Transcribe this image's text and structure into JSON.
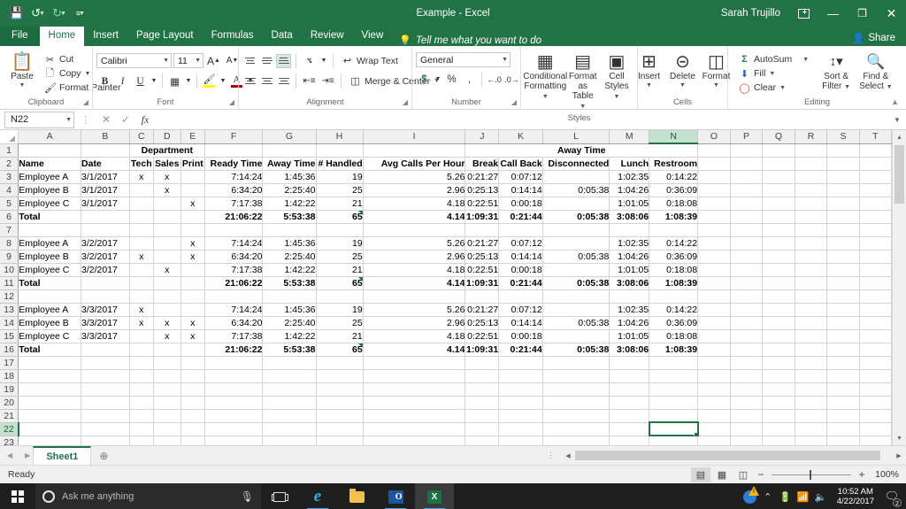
{
  "window": {
    "title": "Example  -  Excel",
    "user": "Sarah Trujillo",
    "qat": {
      "save": "save-icon",
      "undo": "undo-icon",
      "redo": "redo-icon",
      "customize": "customize-icon"
    },
    "buttons": {
      "account": "account-icon",
      "minimize": "—",
      "restore": "❐",
      "close": "✕"
    }
  },
  "tabs": {
    "items": [
      "File",
      "Home",
      "Insert",
      "Page Layout",
      "Formulas",
      "Data",
      "Review",
      "View"
    ],
    "active": "Home",
    "tellme": "Tell me what you want to do",
    "share": "Share"
  },
  "ribbon": {
    "clipboard": {
      "label": "Clipboard",
      "paste": "Paste",
      "cut": "Cut",
      "copy": "Copy",
      "format_painter": "Format Painter"
    },
    "font": {
      "label": "Font",
      "name": "Calibri",
      "size": "11",
      "bold": "B",
      "italic": "I",
      "underline": "U",
      "grow": "A",
      "shrink": "A",
      "borders": "borders-icon",
      "fill": "fill-color-icon",
      "fontcolor": "font-color-icon"
    },
    "alignment": {
      "label": "Alignment",
      "wrap_text": "Wrap Text",
      "merge_center": "Merge & Center",
      "orientation": "orientation-icon",
      "indent_dec": "decrease-indent-icon",
      "indent_inc": "increase-indent-icon"
    },
    "number": {
      "label": "Number",
      "format": "General",
      "currency": "$",
      "percent": "%",
      "comma": ",",
      "inc_decimal": "increase-decimal-icon",
      "dec_decimal": "decrease-decimal-icon"
    },
    "styles": {
      "label": "Styles",
      "conditional_formatting": [
        "Conditional",
        "Formatting"
      ],
      "format_as_table": [
        "Format as",
        "Table"
      ],
      "cell_styles": [
        "Cell",
        "Styles"
      ]
    },
    "cells": {
      "label": "Cells",
      "insert": "Insert",
      "delete": "Delete",
      "format": "Format"
    },
    "editing": {
      "label": "Editing",
      "autosum": "AutoSum",
      "fill": "Fill",
      "clear": "Clear",
      "sort_filter": [
        "Sort &",
        "Filter"
      ],
      "find_select": [
        "Find &",
        "Select"
      ],
      "collapse": "collapse-ribbon-icon"
    }
  },
  "formula_bar": {
    "name_box": "N22",
    "formula": "",
    "cancel": "✕",
    "enter": "✓",
    "fx": "fx"
  },
  "grid": {
    "columns": [
      "A",
      "B",
      "C",
      "D",
      "E",
      "F",
      "G",
      "H",
      "I",
      "J",
      "K",
      "L",
      "M",
      "N",
      "O",
      "P",
      "Q",
      "R",
      "S",
      "T"
    ],
    "selected_column": "N",
    "selected_row": 22,
    "selected_cell": "N22",
    "rows": [
      {
        "n": 1,
        "type": "group-header",
        "cells": {
          "D": "Department",
          "L": "Away Time"
        }
      },
      {
        "n": 2,
        "type": "header",
        "cells": {
          "A": "Name",
          "B": "Date",
          "C": "Tech",
          "D": "Sales",
          "E": "Print",
          "F": "Ready Time",
          "G": "Away Time",
          "H": "# Handled",
          "I": "Avg Calls Per Hour",
          "J": "Break",
          "K": "Call Back",
          "L": "Disconnected",
          "M": "Lunch",
          "N": "Restroom"
        }
      },
      {
        "n": 3,
        "type": "data",
        "cells": {
          "A": "Employee A",
          "B": "3/1/2017",
          "C": "x",
          "D": "x",
          "E": "",
          "F": "7:14:24",
          "G": "1:45:36",
          "H": "19",
          "I": "5.26",
          "J": "0:21:27",
          "K": "0:07:12",
          "L": "",
          "M": "1:02:35",
          "N": "0:14:22"
        }
      },
      {
        "n": 4,
        "type": "data",
        "cells": {
          "A": "Employee B",
          "B": "3/1/2017",
          "C": "",
          "D": "x",
          "E": "",
          "F": "6:34:20",
          "G": "2:25:40",
          "H": "25",
          "I": "2.96",
          "J": "0:25:13",
          "K": "0:14:14",
          "L": "0:05:38",
          "M": "1:04:26",
          "N": "0:36:09"
        }
      },
      {
        "n": 5,
        "type": "data",
        "cells": {
          "A": "Employee C",
          "B": "3/1/2017",
          "C": "",
          "D": "",
          "E": "x",
          "F": "7:17:38",
          "G": "1:42:22",
          "H": "21",
          "I": "4.18",
          "J": "0:22:51",
          "K": "0:00:18",
          "L": "",
          "M": "1:01:05",
          "N": "0:18:08"
        }
      },
      {
        "n": 6,
        "type": "total",
        "cells": {
          "A": "Total",
          "B": "",
          "C": "",
          "D": "",
          "E": "",
          "F": "21:06:22",
          "G": "5:53:38",
          "H": "65",
          "I": "4.14",
          "J": "1:09:31",
          "K": "0:21:44",
          "L": "0:05:38",
          "M": "3:08:06",
          "N": "1:08:39"
        }
      },
      {
        "n": 7,
        "type": "blank",
        "cells": {}
      },
      {
        "n": 8,
        "type": "data",
        "cells": {
          "A": "Employee A",
          "B": "3/2/2017",
          "C": "",
          "D": "",
          "E": "x",
          "F": "7:14:24",
          "G": "1:45:36",
          "H": "19",
          "I": "5.26",
          "J": "0:21:27",
          "K": "0:07:12",
          "L": "",
          "M": "1:02:35",
          "N": "0:14:22"
        }
      },
      {
        "n": 9,
        "type": "data",
        "cells": {
          "A": "Employee B",
          "B": "3/2/2017",
          "C": "x",
          "D": "",
          "E": "x",
          "F": "6:34:20",
          "G": "2:25:40",
          "H": "25",
          "I": "2.96",
          "J": "0:25:13",
          "K": "0:14:14",
          "L": "0:05:38",
          "M": "1:04:26",
          "N": "0:36:09"
        }
      },
      {
        "n": 10,
        "type": "data",
        "cells": {
          "A": "Employee C",
          "B": "3/2/2017",
          "C": "",
          "D": "x",
          "E": "",
          "F": "7:17:38",
          "G": "1:42:22",
          "H": "21",
          "I": "4.18",
          "J": "0:22:51",
          "K": "0:00:18",
          "L": "",
          "M": "1:01:05",
          "N": "0:18:08"
        }
      },
      {
        "n": 11,
        "type": "total",
        "cells": {
          "A": "Total",
          "B": "",
          "C": "",
          "D": "",
          "E": "",
          "F": "21:06:22",
          "G": "5:53:38",
          "H": "65",
          "I": "4.14",
          "J": "1:09:31",
          "K": "0:21:44",
          "L": "0:05:38",
          "M": "3:08:06",
          "N": "1:08:39"
        }
      },
      {
        "n": 12,
        "type": "blank",
        "cells": {}
      },
      {
        "n": 13,
        "type": "data",
        "cells": {
          "A": "Employee A",
          "B": "3/3/2017",
          "C": "x",
          "D": "",
          "E": "",
          "F": "7:14:24",
          "G": "1:45:36",
          "H": "19",
          "I": "5.26",
          "J": "0:21:27",
          "K": "0:07:12",
          "L": "",
          "M": "1:02:35",
          "N": "0:14:22"
        }
      },
      {
        "n": 14,
        "type": "data",
        "cells": {
          "A": "Employee B",
          "B": "3/3/2017",
          "C": "x",
          "D": "x",
          "E": "x",
          "F": "6:34:20",
          "G": "2:25:40",
          "H": "25",
          "I": "2.96",
          "J": "0:25:13",
          "K": "0:14:14",
          "L": "0:05:38",
          "M": "1:04:26",
          "N": "0:36:09"
        }
      },
      {
        "n": 15,
        "type": "data",
        "cells": {
          "A": "Employee C",
          "B": "3/3/2017",
          "C": "",
          "D": "x",
          "E": "x",
          "F": "7:17:38",
          "G": "1:42:22",
          "H": "21",
          "I": "4.18",
          "J": "0:22:51",
          "K": "0:00:18",
          "L": "",
          "M": "1:01:05",
          "N": "0:18:08"
        }
      },
      {
        "n": 16,
        "type": "total",
        "cells": {
          "A": "Total",
          "B": "",
          "C": "",
          "D": "",
          "E": "",
          "F": "21:06:22",
          "G": "5:53:38",
          "H": "65",
          "I": "4.14",
          "J": "1:09:31",
          "K": "0:21:44",
          "L": "0:05:38",
          "M": "3:08:06",
          "N": "1:08:39"
        }
      },
      {
        "n": 17,
        "type": "blank",
        "cells": {}
      },
      {
        "n": 18,
        "type": "blank",
        "cells": {}
      },
      {
        "n": 19,
        "type": "blank",
        "cells": {}
      },
      {
        "n": 20,
        "type": "blank",
        "cells": {}
      },
      {
        "n": 21,
        "type": "blank",
        "cells": {}
      },
      {
        "n": 22,
        "type": "blank",
        "cells": {}
      },
      {
        "n": 23,
        "type": "blank",
        "cells": {}
      }
    ]
  },
  "sheet_tabs": {
    "sheets": [
      "Sheet1"
    ],
    "active": "Sheet1",
    "add_label": "⊕",
    "prev": "◀",
    "next": "▶"
  },
  "status_bar": {
    "status": "Ready",
    "views": [
      "normal-view",
      "page-layout-view",
      "page-break-view"
    ],
    "active_view": "normal-view",
    "zoom": "100%",
    "zoom_out": "−",
    "zoom_in": "+"
  },
  "taskbar": {
    "start": "start-button",
    "search_placeholder": "Ask me anything",
    "apps": [
      "task-view",
      "microsoft-edge",
      "file-explorer",
      "outlook",
      "excel"
    ],
    "active_app": "excel",
    "tray": {
      "update": "update-icon",
      "chevron": "⌃",
      "battery": "battery-icon",
      "network": "wifi-icon",
      "volume": "volume-icon"
    },
    "clock": {
      "time": "10:52 AM",
      "date": "4/22/2017"
    },
    "notifications": "2"
  },
  "colors": {
    "excel_green": "#217346",
    "ribbon_bg": "#ffffff",
    "grid_line": "#d4d4d4",
    "selection": "#217346"
  }
}
